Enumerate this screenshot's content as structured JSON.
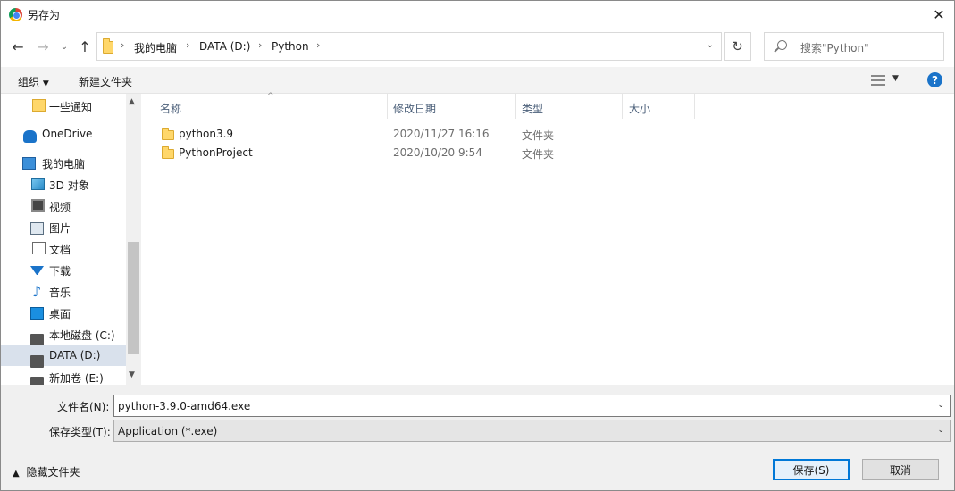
{
  "window": {
    "title": "另存为"
  },
  "address": {
    "crumbs": [
      "我的电脑",
      "DATA (D:)",
      "Python"
    ],
    "search_placeholder": "搜索\"Python\""
  },
  "toolbar": {
    "organize": "组织",
    "new_folder": "新建文件夹"
  },
  "nav": {
    "items": [
      {
        "label": "一些通知",
        "icon": "folder-icon"
      },
      {
        "label": "OneDrive",
        "icon": "cloud-icon"
      },
      {
        "label": "我的电脑",
        "icon": "computer-icon"
      },
      {
        "label": "3D 对象",
        "icon": "3d-objects-icon"
      },
      {
        "label": "视频",
        "icon": "video-icon"
      },
      {
        "label": "图片",
        "icon": "pictures-icon"
      },
      {
        "label": "文档",
        "icon": "documents-icon"
      },
      {
        "label": "下载",
        "icon": "download-icon"
      },
      {
        "label": "音乐",
        "icon": "music-icon"
      },
      {
        "label": "桌面",
        "icon": "desktop-icon"
      },
      {
        "label": "本地磁盘 (C:)",
        "icon": "drive-icon"
      },
      {
        "label": "DATA (D:)",
        "icon": "drive-icon",
        "selected": true
      },
      {
        "label": "新加卷 (E:)",
        "icon": "drive-icon"
      }
    ]
  },
  "columns": {
    "name": "名称",
    "date": "修改日期",
    "type": "类型",
    "size": "大小"
  },
  "files": [
    {
      "name": "python3.9",
      "date": "2020/11/27 16:16",
      "type": "文件夹"
    },
    {
      "name": "PythonProject",
      "date": "2020/10/20 9:54",
      "type": "文件夹"
    }
  ],
  "bottom": {
    "filename_label": "文件名(N):",
    "filename_value": "python-3.9.0-amd64.exe",
    "filetype_label": "保存类型(T):",
    "filetype_value": "Application (*.exe)",
    "hide_folders": "隐藏文件夹",
    "save": "保存(S)",
    "cancel": "取消"
  }
}
